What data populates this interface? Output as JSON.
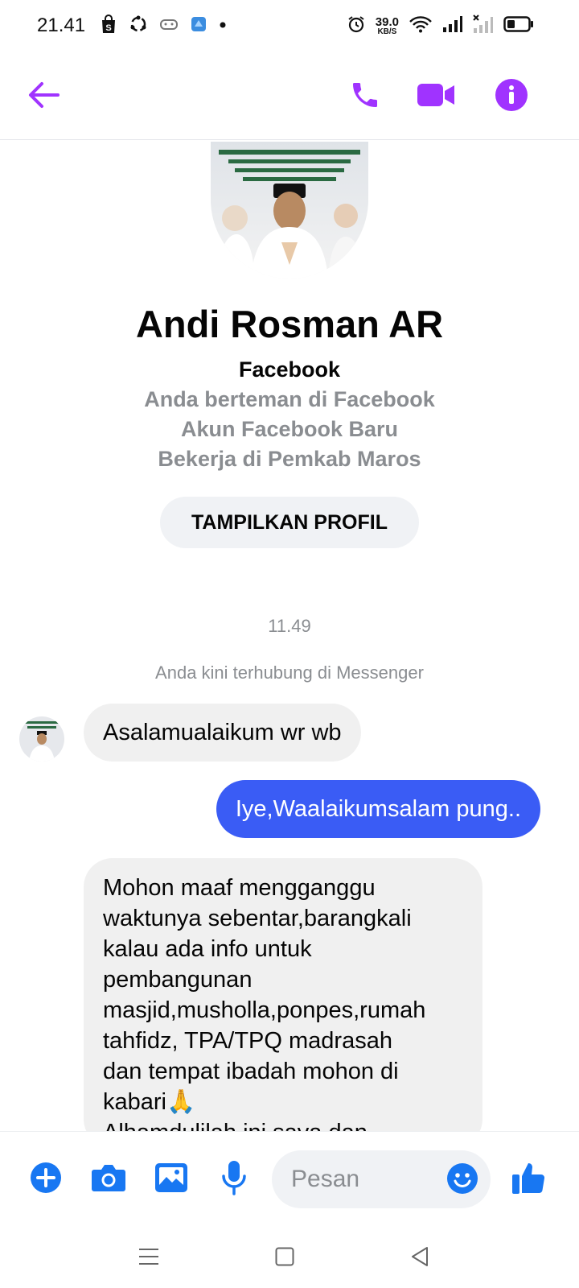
{
  "status_bar": {
    "time": "21.41",
    "speed_value": "39.0",
    "speed_unit": "KB/S",
    "icons": [
      "shopping-bag-icon",
      "sync-icon",
      "game-controller-icon",
      "app-cube-icon",
      "dot-icon",
      "alarm-icon",
      "wifi-icon",
      "signal-icon",
      "signal-no-service-icon",
      "battery-icon"
    ]
  },
  "header": {
    "icons": [
      "back-arrow-icon",
      "phone-icon",
      "video-camera-icon",
      "info-icon"
    ],
    "accent_color": "#a033ff"
  },
  "profile": {
    "name": "Andi Rosman AR",
    "network": "Facebook",
    "lines": [
      "Anda berteman di Facebook",
      "Akun Facebook Baru",
      "Bekerja di Pemkab Maros"
    ],
    "button_label": "TAMPILKAN PROFIL"
  },
  "conversation": {
    "timestamp": "11.49",
    "system_message": "Anda kini terhubung di Messenger",
    "messages": [
      {
        "direction": "incoming",
        "text": "Asalamualaikum wr wb"
      },
      {
        "direction": "outgoing",
        "text": "Iye,Waalaikumsalam pung.."
      },
      {
        "direction": "incoming",
        "lines": [
          "Mohon maaf mengganggu",
          "waktunya sebentar,barangkali",
          "kalau ada info untuk",
          "pembangunan",
          "masjid,musholla,ponpes,rumah",
          "tahfidz, TPA/TPQ madrasah",
          "dan tempat ibadah mohon di",
          "kabari🙏",
          "Alhamdulilah ini saya dan"
        ]
      }
    ],
    "outgoing_color": "#3a5cf5",
    "incoming_color": "#f0f0f0"
  },
  "composer": {
    "placeholder": "Pesan",
    "icons": [
      "plus-icon",
      "camera-icon",
      "image-icon",
      "microphone-icon",
      "emoji-icon",
      "thumbs-up-icon"
    ],
    "icon_color": "#1877f2"
  },
  "nav_bar": {
    "icons": [
      "menu-icon",
      "home-square-icon",
      "back-triangle-icon"
    ]
  }
}
